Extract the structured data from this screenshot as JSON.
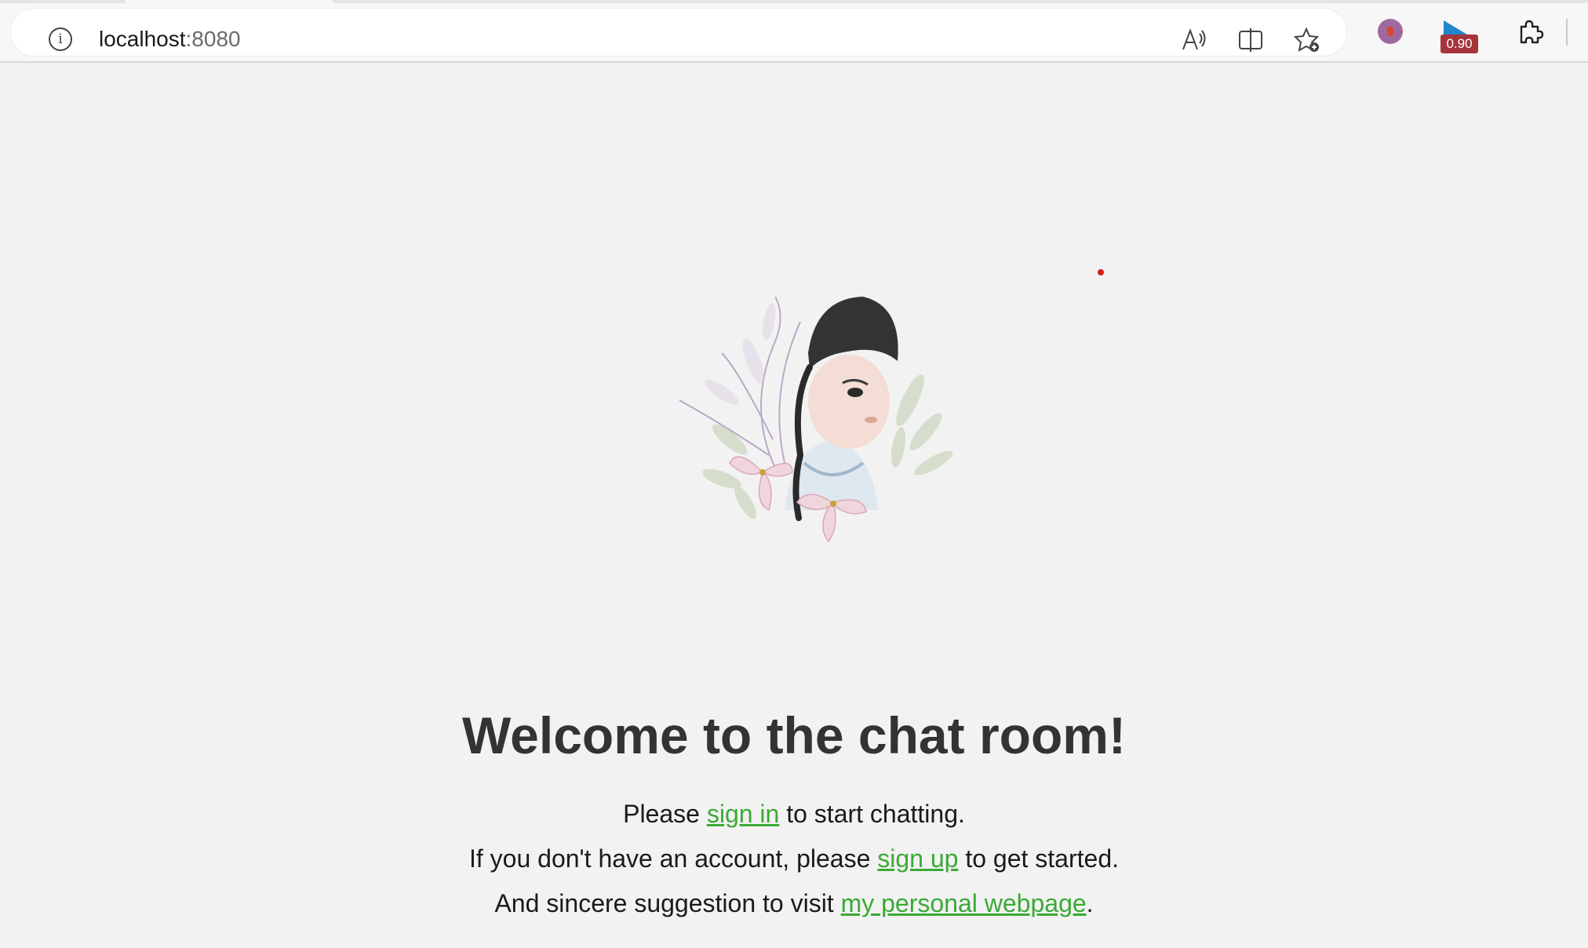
{
  "browser": {
    "url_host": "localhost",
    "url_port": ":8080",
    "extension_badge": "0.90"
  },
  "colors": {
    "link": "#3aaa35",
    "heading": "#333333",
    "background": "#f2f2f2",
    "badge_bg": "#a8343b"
  },
  "icons": [
    "info-icon",
    "read-aloud-icon",
    "split-screen-icon",
    "favorite-add-icon",
    "profile-extension-icon",
    "flag-extension-icon",
    "extensions-puzzle-icon"
  ],
  "main": {
    "heading": "Welcome to the chat room!",
    "line1": {
      "before": "Please ",
      "link": "sign in",
      "after": " to start chatting."
    },
    "line2": {
      "before": "If you don't have an account, please ",
      "link": "sign up",
      "after": " to get started."
    },
    "line3": {
      "before": "And sincere suggestion to visit ",
      "link": "my personal webpage",
      "after": "."
    }
  }
}
